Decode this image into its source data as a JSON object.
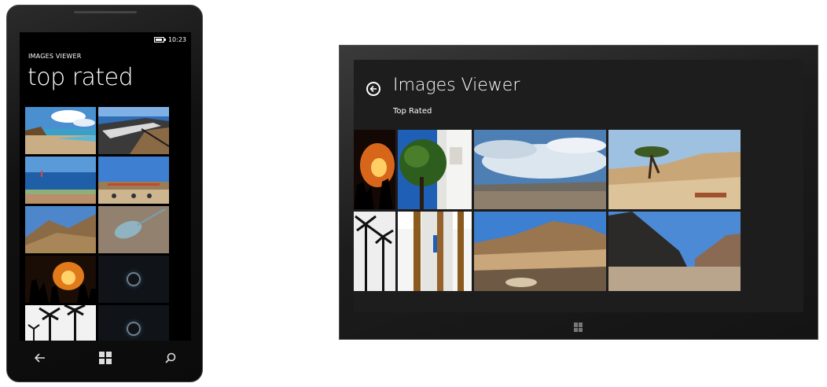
{
  "phone": {
    "status_time": "10:23",
    "app_title": "IMAGES VIEWER",
    "page_title": "top rated",
    "tiles": [
      {
        "name": "photo-beach-lagoon"
      },
      {
        "name": "photo-seaside-promenade"
      },
      {
        "name": "photo-sea-horizon"
      },
      {
        "name": "photo-pier-blue-sky"
      },
      {
        "name": "photo-desert-mountain"
      },
      {
        "name": "photo-stingray"
      },
      {
        "name": "photo-campfire-silhouettes"
      },
      {
        "name": "loading-placeholder"
      },
      {
        "name": "photo-palm-silhouettes"
      },
      {
        "name": "loading-placeholder"
      }
    ],
    "nav_icons": [
      "back-arrow-icon",
      "windows-start-icon",
      "search-icon"
    ]
  },
  "tablet": {
    "app_title": "Images Viewer",
    "subtitle": "Top Rated",
    "back_icon": "back-arrow-circle-icon",
    "home_icon": "windows-start-icon"
  },
  "colors": {
    "screen_background": "#000000",
    "tablet_background": "#1d1d1d",
    "text": "#ffffff"
  }
}
